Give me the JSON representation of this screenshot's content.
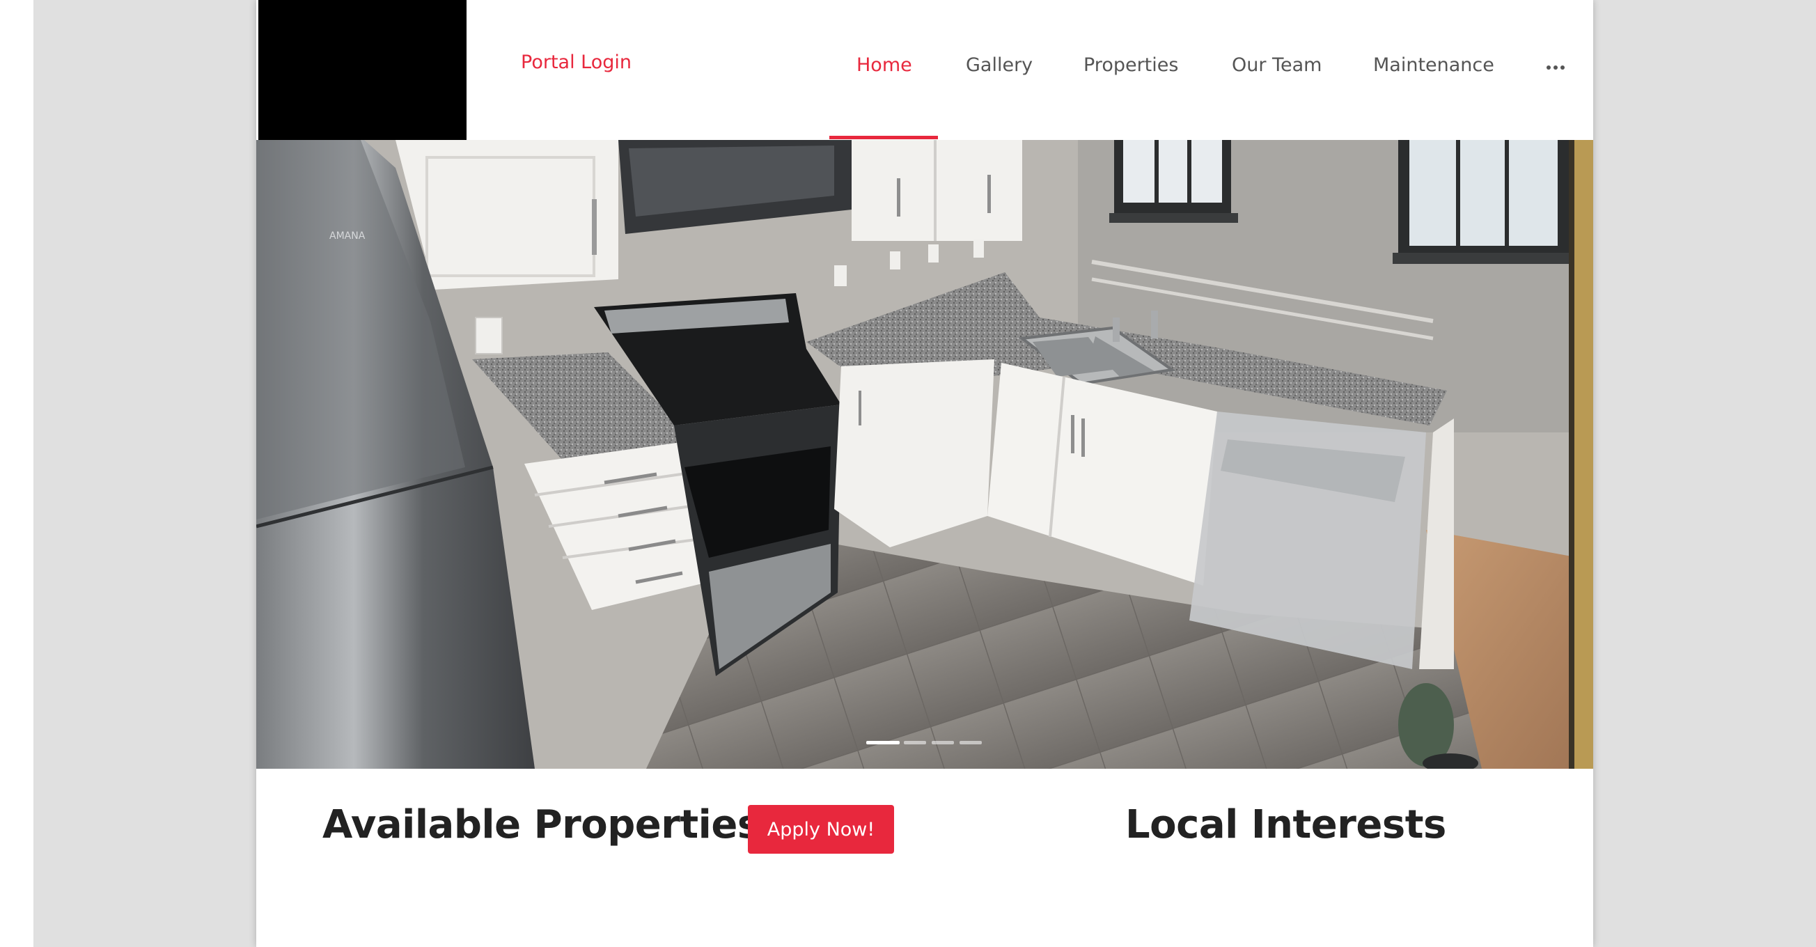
{
  "header": {
    "portal_login": "Portal Login",
    "nav": [
      {
        "label": "Home",
        "active": true
      },
      {
        "label": "Gallery",
        "active": false
      },
      {
        "label": "Properties",
        "active": false
      },
      {
        "label": "Our Team",
        "active": false
      },
      {
        "label": "Maintenance",
        "active": false
      }
    ],
    "more_icon": "more-horizontal-icon"
  },
  "hero": {
    "image": "kitchen-photo",
    "slide_count": 4,
    "active_slide": 1
  },
  "sections": {
    "available_properties": "Available Properties",
    "apply_button": "Apply Now!",
    "local_interests": "Local Interests"
  },
  "colors": {
    "accent": "#e8283d",
    "nav_text": "#555555",
    "heading": "#222222",
    "backdrop": "#e0e0e0"
  }
}
